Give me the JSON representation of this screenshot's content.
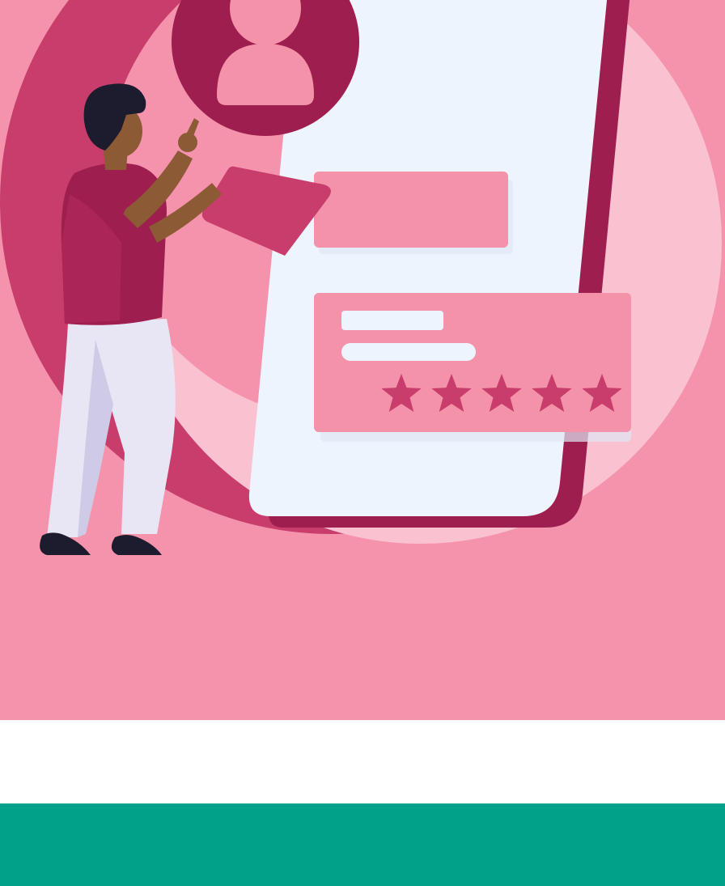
{
  "illustration": {
    "icons": {
      "person": "person-illustration",
      "phone": "smartphone-illustration",
      "avatar": "user-avatar-icon",
      "card": "floating-card",
      "star": "star-icon"
    },
    "rating": {
      "stars_filled": 5,
      "stars_total": 5
    }
  },
  "colors": {
    "background_pink": "#f593ad",
    "dark_magenta": "#9d1e4f",
    "rose": "#c83d6b",
    "light_pink": "#fac2d0",
    "card_pink": "#f392a8",
    "phone_screen": "#eef4fd",
    "white_band": "#ffffff",
    "green_band": "#00a089",
    "hair_shoes": "#1d1c2e",
    "skin": "#8c5a35",
    "pants": "#e8e5f5"
  }
}
